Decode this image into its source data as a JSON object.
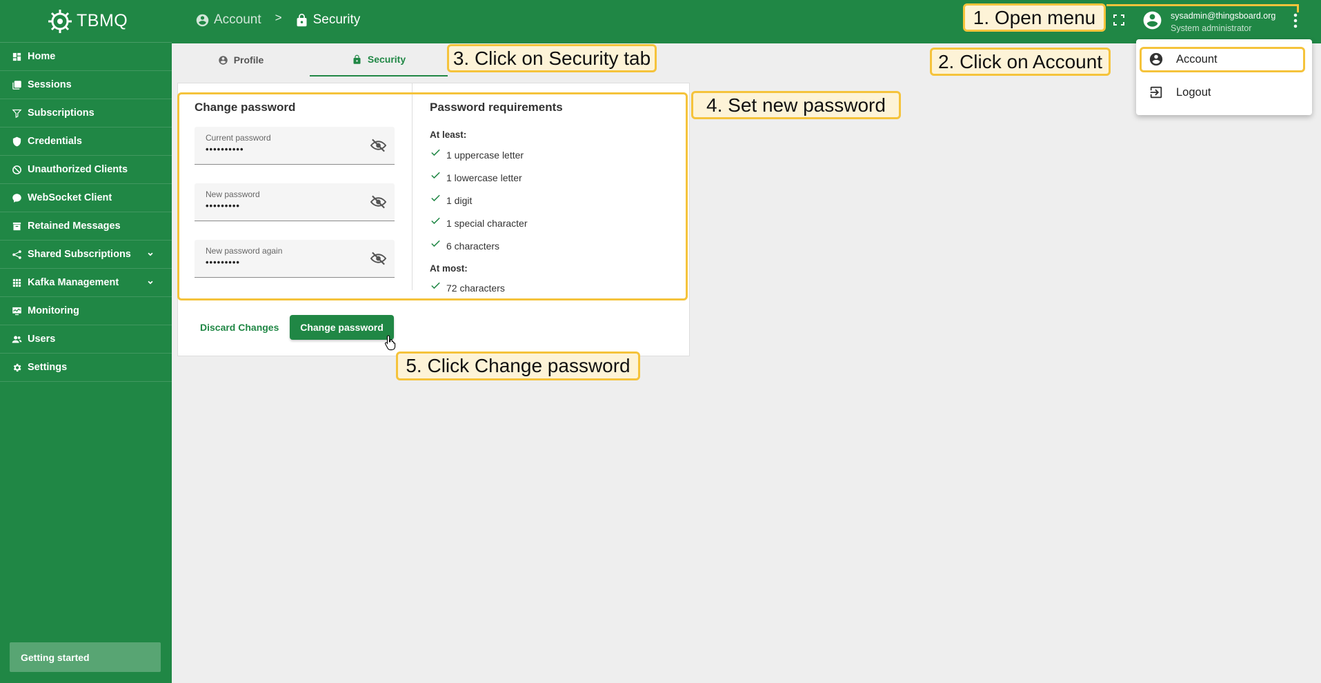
{
  "app": {
    "name": "TBMQ"
  },
  "sidebar": {
    "items": [
      {
        "label": "Home",
        "icon": "dashboard-icon"
      },
      {
        "label": "Sessions",
        "icon": "sessions-icon"
      },
      {
        "label": "Subscriptions",
        "icon": "filter-icon"
      },
      {
        "label": "Credentials",
        "icon": "shield-icon"
      },
      {
        "label": "Unauthorized Clients",
        "icon": "no-access-icon"
      },
      {
        "label": "WebSocket Client",
        "icon": "chat-icon"
      },
      {
        "label": "Retained Messages",
        "icon": "archive-icon"
      },
      {
        "label": "Shared Subscriptions",
        "icon": "share-icon",
        "expandable": true
      },
      {
        "label": "Kafka Management",
        "icon": "grid-icon",
        "expandable": true
      },
      {
        "label": "Monitoring",
        "icon": "monitor-icon"
      },
      {
        "label": "Users",
        "icon": "people-icon"
      },
      {
        "label": "Settings",
        "icon": "gear-icon"
      }
    ],
    "getting_started": "Getting started"
  },
  "header": {
    "breadcrumb": [
      {
        "label": "Account",
        "icon": "account-circle-icon"
      },
      {
        "label": "Security",
        "icon": "lock-icon"
      }
    ],
    "separator": ">",
    "user": {
      "email": "sysadmin@thingsboard.org",
      "role": "System administrator"
    }
  },
  "tabs": [
    {
      "label": "Profile",
      "icon": "account-circle-icon",
      "active": false
    },
    {
      "label": "Security",
      "icon": "lock-icon",
      "active": true
    }
  ],
  "change_password": {
    "title": "Change password",
    "fields": [
      {
        "label": "Current password",
        "value": "••••••••••"
      },
      {
        "label": "New password",
        "value": "•••••••••"
      },
      {
        "label": "New password again",
        "value": "•••••••••"
      }
    ]
  },
  "requirements": {
    "title": "Password requirements",
    "at_least_label": "At least:",
    "at_least": [
      "1 uppercase letter",
      "1 lowercase letter",
      "1 digit",
      "1 special character",
      "6 characters"
    ],
    "at_most_label": "At most:",
    "at_most": [
      "72 characters"
    ]
  },
  "actions": {
    "discard": "Discard Changes",
    "submit": "Change password"
  },
  "dropdown": {
    "items": [
      {
        "label": "Account",
        "icon": "account-circle-icon"
      },
      {
        "label": "Logout",
        "icon": "logout-icon"
      }
    ]
  },
  "annotations": {
    "step1": "1. Open menu",
    "step2": "2. Click on Account",
    "step3": "3. Click on Security tab",
    "step4": "4. Set new password",
    "step5": "5. Click Change password"
  },
  "colors": {
    "primary": "#208745",
    "highlight": "#f5c33b",
    "callout_bg": "#fdf3d7",
    "background": "#eeeeee"
  }
}
